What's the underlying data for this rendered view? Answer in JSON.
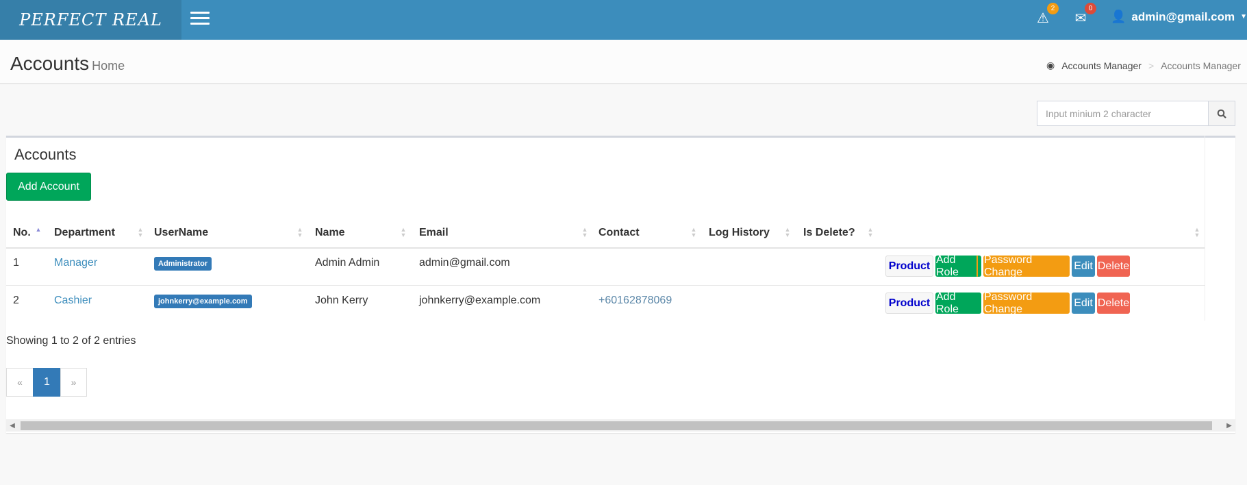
{
  "app": {
    "logo": "PERFECT REAL"
  },
  "navbar": {
    "alerts_count": "2",
    "messages_count": "0",
    "user": "admin@gmail.com",
    "colors": {
      "alert": "#f39c12",
      "message": "#dd4b39"
    }
  },
  "header": {
    "title": "Accounts",
    "subtitle": "Home",
    "breadcrumb": [
      "Accounts Manager",
      ">",
      "Accounts Manager"
    ]
  },
  "search": {
    "placeholder": "Input minium 2 character"
  },
  "box": {
    "title": "Accounts",
    "add_button": "Add Account"
  },
  "table": {
    "columns": [
      "No.",
      "Department",
      "UserName",
      "Name",
      "Email",
      "Contact",
      "Log History",
      "Is Delete?",
      ""
    ],
    "rows": [
      {
        "no": "1",
        "department": "Manager",
        "username": "Administrator",
        "name": "Admin Admin",
        "email": "admin@gmail.com",
        "contact": "",
        "actions": [
          "Product",
          "Add Role",
          "Password Change",
          "Edit",
          "Delete"
        ]
      },
      {
        "no": "2",
        "department": "Cashier",
        "username": "johnkerry@example.com",
        "name": "John Kerry",
        "email": "johnkerry@example.com",
        "contact": "+60162878069",
        "actions": [
          "Product",
          "Add Role",
          "Password Change",
          "Edit",
          "Delete"
        ]
      }
    ]
  },
  "footer": {
    "info": "Showing 1 to 2 of 2 entries",
    "pagination": [
      "«",
      "1",
      "»"
    ]
  }
}
